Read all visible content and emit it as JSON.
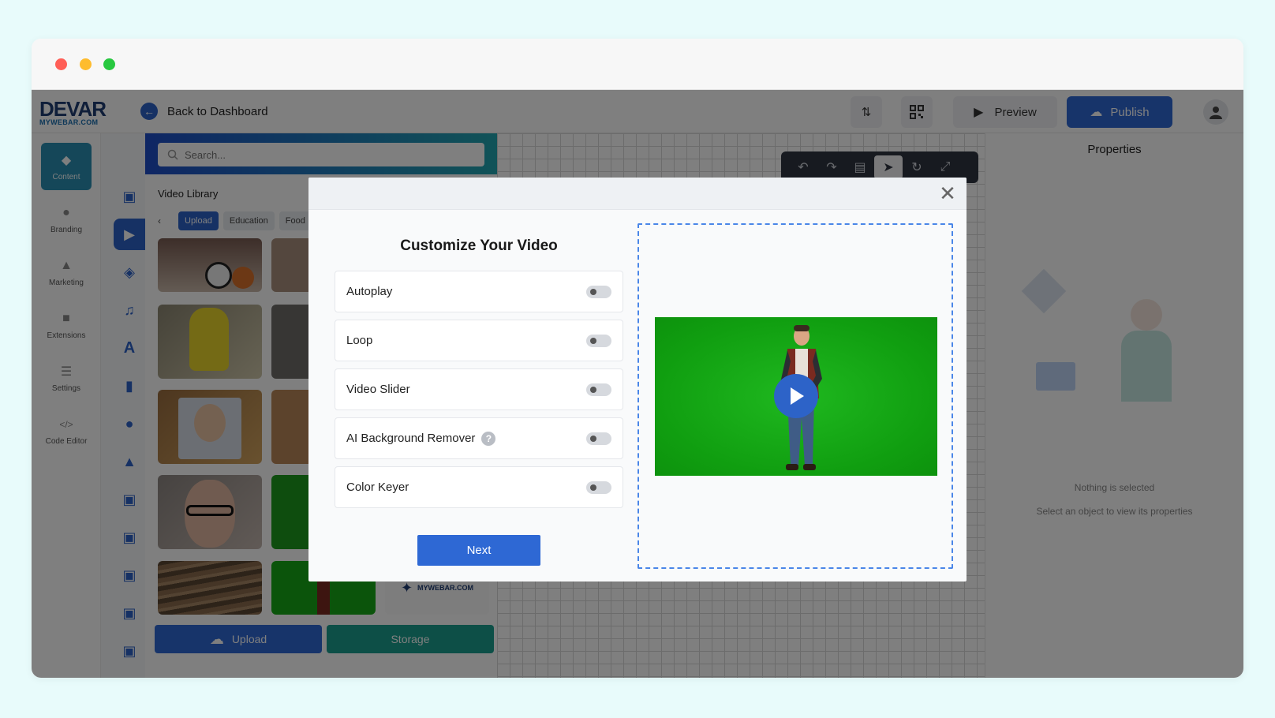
{
  "header": {
    "logo_main": "DEVAR",
    "logo_sub": "MYWEBAR.COM",
    "back_label": "Back to Dashboard",
    "preview_label": "Preview",
    "publish_label": "Publish"
  },
  "leftnav": {
    "items": [
      {
        "label": "Content",
        "icon": "layers-icon"
      },
      {
        "label": "Branding",
        "icon": "palette-icon"
      },
      {
        "label": "Marketing",
        "icon": "thumbs-up-icon"
      },
      {
        "label": "Extensions",
        "icon": "puzzle-icon"
      },
      {
        "label": "Settings",
        "icon": "sliders-icon"
      },
      {
        "label": "Code Editor",
        "icon": "code-icon"
      }
    ]
  },
  "library": {
    "search_placeholder": "Search...",
    "title": "Video Library",
    "tabs": [
      "Upload",
      "Education",
      "Food"
    ],
    "upload_label": "Upload",
    "storage_label": "Storage",
    "thumb_brand": "MYWEBAR.COM"
  },
  "properties": {
    "title": "Properties",
    "nothing_selected": "Nothing is selected",
    "hint": "Select an object to view its properties"
  },
  "modal": {
    "title": "Customize Your Video",
    "options": [
      {
        "label": "Autoplay",
        "enabled": false
      },
      {
        "label": "Loop",
        "enabled": false
      },
      {
        "label": "Video Slider",
        "enabled": false
      },
      {
        "label": "AI Background Remover",
        "enabled": false,
        "help": "?"
      },
      {
        "label": "Color Keyer",
        "enabled": false
      }
    ],
    "next_label": "Next"
  },
  "colors": {
    "accent": "#2e68d4",
    "storage": "#1a9e8e",
    "chroma_green": "#15a815"
  }
}
